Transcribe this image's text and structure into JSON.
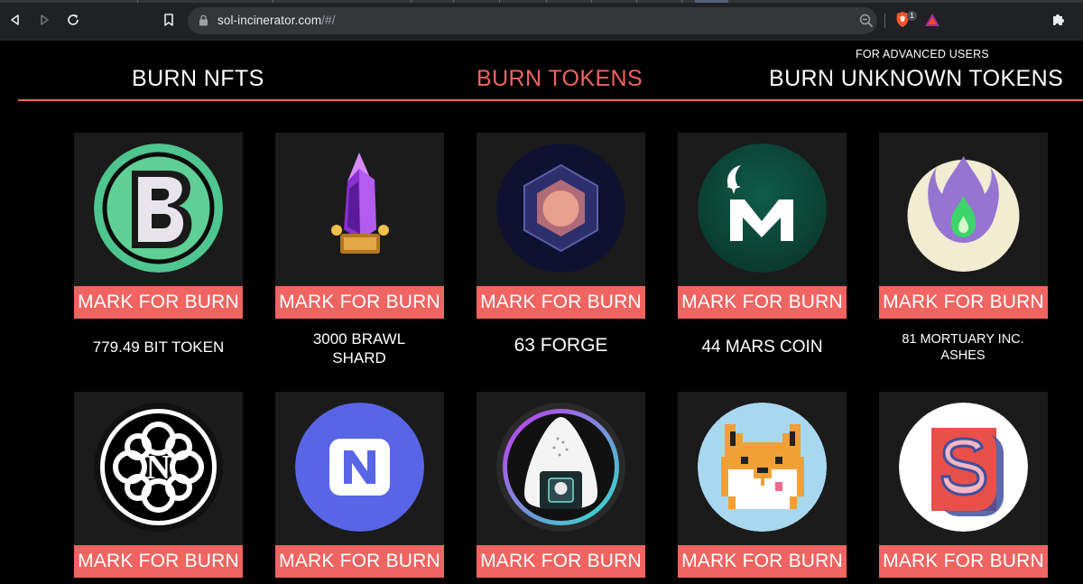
{
  "browser": {
    "url_host": "sol-incinerator.com",
    "url_path": "/#/",
    "shields_count": "1",
    "icons": [
      "back-icon",
      "forward-icon",
      "reload-icon",
      "bookmark-icon",
      "lock-icon",
      "zoom-out-icon",
      "brave-shields-icon",
      "brave-rewards-icon",
      "extensions-icon"
    ]
  },
  "nav": {
    "advanced_label": "FOR ADVANCED USERS",
    "tabs": [
      {
        "label": "BURN NFTS",
        "active": false
      },
      {
        "label": "BURN TOKENS",
        "active": true
      },
      {
        "label": "BURN UNKNOWN TOKENS",
        "active": false
      }
    ]
  },
  "colors": {
    "accent": "#f0645f",
    "tile": "#1b1b1b",
    "background": "#000000"
  },
  "tokens": [
    {
      "name": "779.49 BIT TOKEN",
      "button": "MARK FOR BURN",
      "logo": "bit-token-logo"
    },
    {
      "name": "3000 BRAWL SHARD",
      "button": "MARK FOR BURN",
      "logo": "brawl-shard-logo"
    },
    {
      "name": "63 FORGE",
      "button": "MARK FOR BURN",
      "logo": "forge-logo"
    },
    {
      "name": "44 MARS COIN",
      "button": "MARK FOR BURN",
      "logo": "mars-coin-logo"
    },
    {
      "name": "81 MORTUARY INC. ASHES",
      "button": "MARK FOR BURN",
      "logo": "mortuary-ashes-logo"
    },
    {
      "name": "",
      "button": "MARK FOR BURN",
      "logo": "knot-logo"
    },
    {
      "name": "",
      "button": "MARK FOR BURN",
      "logo": "n-logo"
    },
    {
      "name": "",
      "button": "MARK FOR BURN",
      "logo": "onigiri-logo"
    },
    {
      "name": "",
      "button": "MARK FOR BURN",
      "logo": "doge-logo"
    },
    {
      "name": "",
      "button": "MARK FOR BURN",
      "logo": "s-logo"
    }
  ]
}
